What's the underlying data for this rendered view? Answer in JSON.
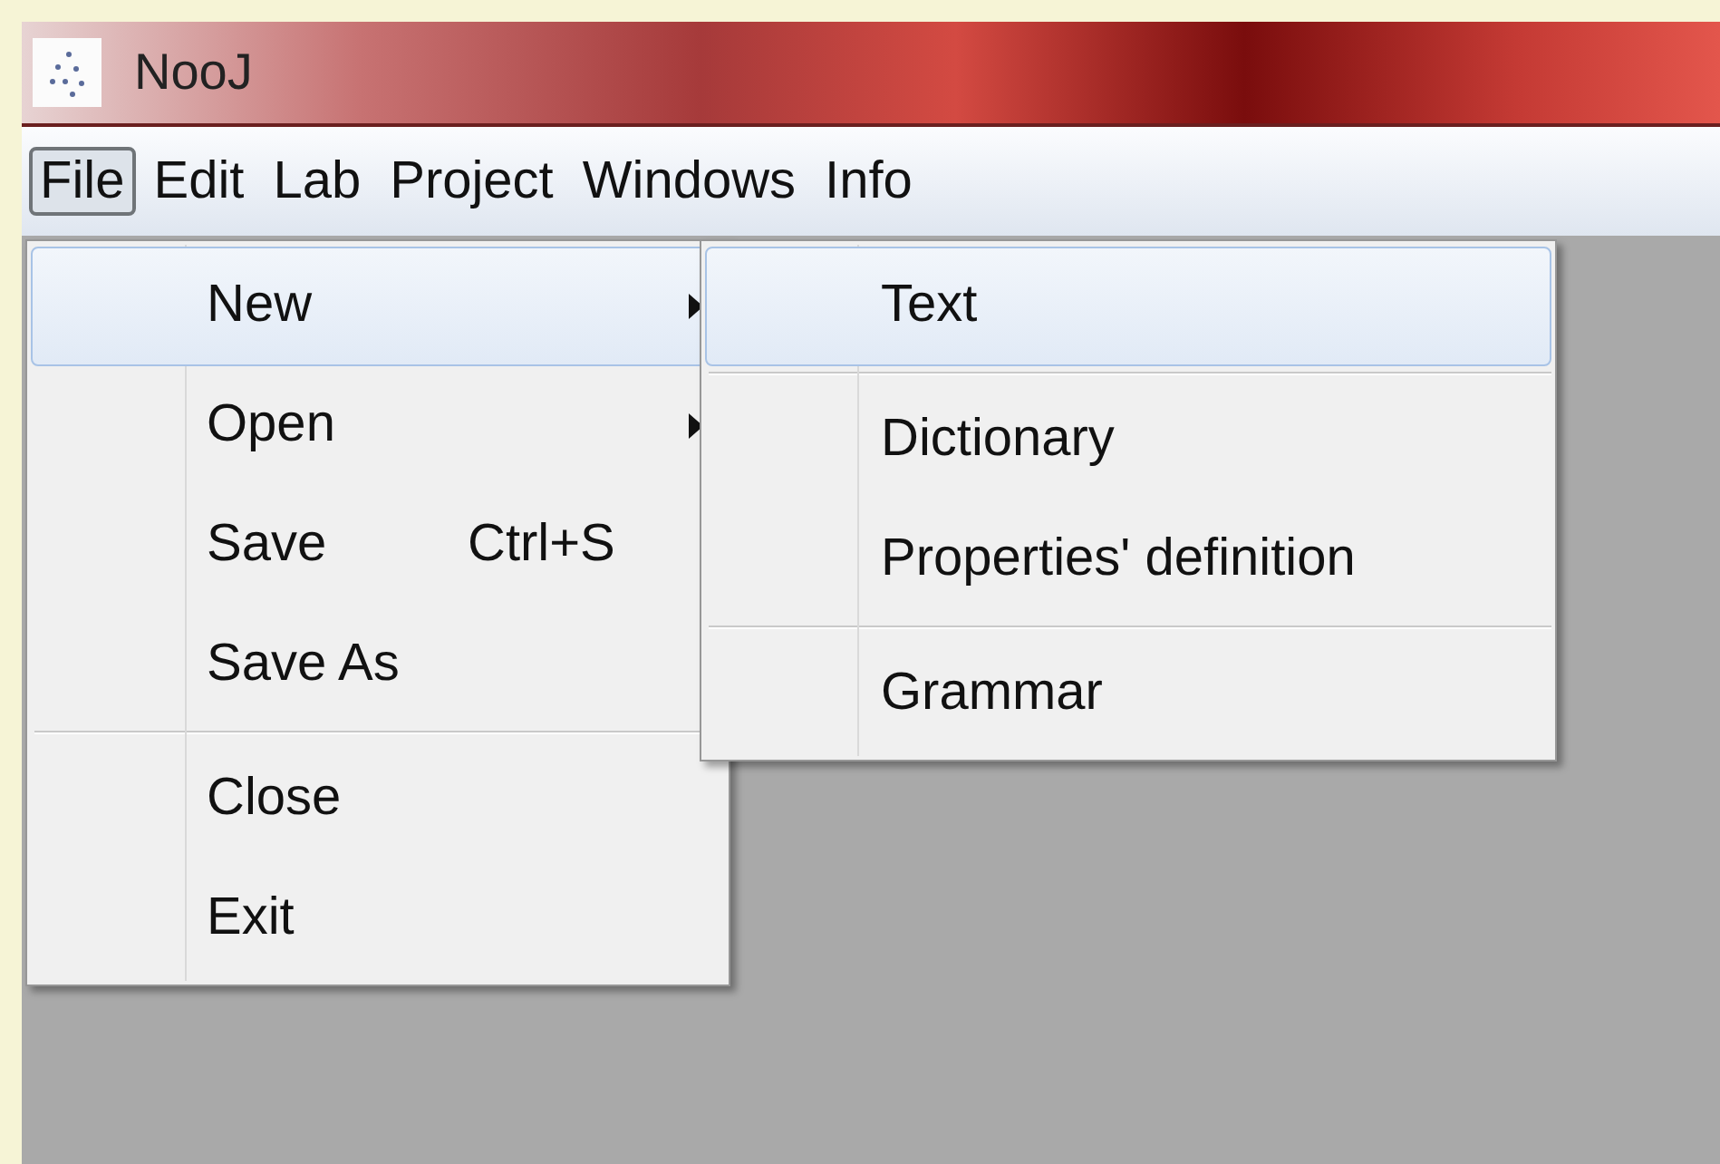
{
  "window": {
    "title": "NooJ"
  },
  "menu_bar": [
    {
      "label": "File",
      "selected": true
    },
    {
      "label": "Edit",
      "selected": false
    },
    {
      "label": "Lab",
      "selected": false
    },
    {
      "label": "Project",
      "selected": false
    },
    {
      "label": "Windows",
      "selected": false
    },
    {
      "label": "Info",
      "selected": false
    }
  ],
  "file_menu": [
    {
      "kind": "item",
      "label": "New",
      "submenu": true,
      "selected": true
    },
    {
      "kind": "item",
      "label": "Open",
      "submenu": true,
      "selected": false
    },
    {
      "kind": "item",
      "label": "Save",
      "shortcut": "Ctrl+S",
      "selected": false
    },
    {
      "kind": "item",
      "label": "Save As",
      "selected": false
    },
    {
      "kind": "separator"
    },
    {
      "kind": "item",
      "label": "Close",
      "selected": false
    },
    {
      "kind": "item",
      "label": "Exit",
      "selected": false
    }
  ],
  "new_submenu": [
    {
      "kind": "item",
      "label": "Text",
      "selected": true
    },
    {
      "kind": "separator"
    },
    {
      "kind": "item",
      "label": "Dictionary",
      "selected": false
    },
    {
      "kind": "item",
      "label": "Properties' definition",
      "selected": false
    },
    {
      "kind": "separator"
    },
    {
      "kind": "item",
      "label": "Grammar",
      "selected": false
    }
  ]
}
